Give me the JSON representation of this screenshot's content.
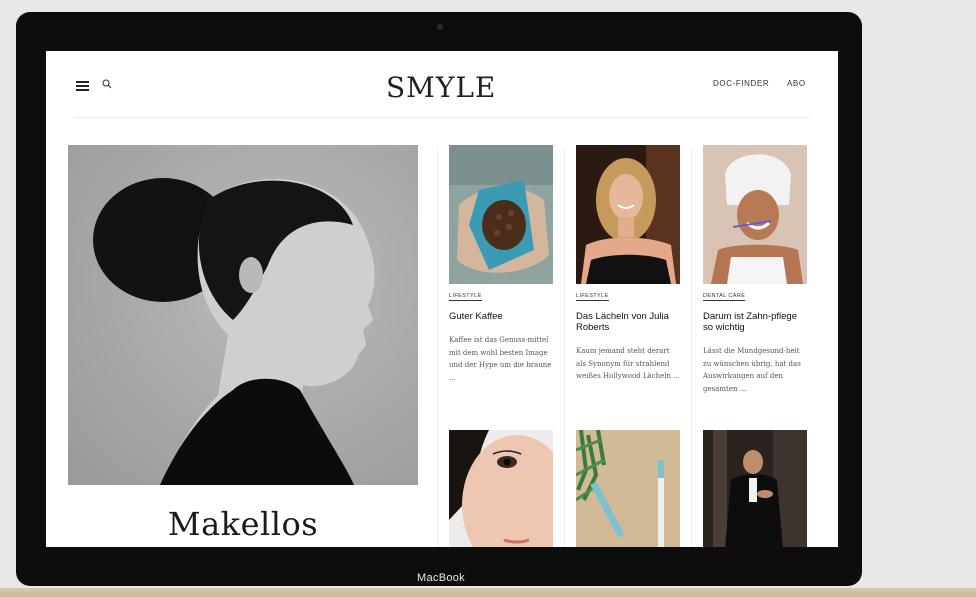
{
  "header": {
    "logo": "SMYLE",
    "nav": [
      "DOC-FINDER",
      "ABO"
    ]
  },
  "hero": {
    "title": "Makellos"
  },
  "articles": [
    {
      "category": "LIFESTYLE",
      "title": "Guter Kaffee",
      "teaser": "Kaffee ist das Genuss-mittel mit dem wohl besten Image und der Hype um die braune ..."
    },
    {
      "category": "LIFESTYLE",
      "title": "Das Lächeln von Julia Roberts",
      "teaser": "Kaum jemand steht derart als Synonym für strahlend weißes Hollywood Lächeln ..."
    },
    {
      "category": "DENTAL CARE",
      "title": "Darum ist Zahn-pflege so wichtig",
      "teaser": "Lässt die Mundgesund-heit zu wünschen übrig, hat das Auswirkungen auf den gesamten ..."
    }
  ],
  "device_label": "MacBook",
  "colors": {
    "accent": "#111111",
    "page_bg": "#ffffff"
  }
}
